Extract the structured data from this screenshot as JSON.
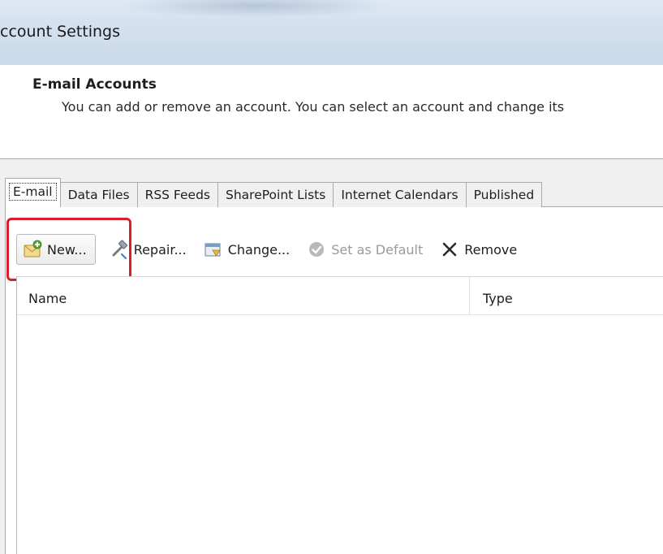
{
  "window": {
    "title": "ccount Settings"
  },
  "header": {
    "heading": "E-mail Accounts",
    "description": "You can add or remove an account. You can select an account and change its"
  },
  "tabs": [
    {
      "label": "E-mail",
      "active": true
    },
    {
      "label": "Data Files"
    },
    {
      "label": "RSS Feeds"
    },
    {
      "label": "SharePoint Lists"
    },
    {
      "label": "Internet Calendars"
    },
    {
      "label": "Published"
    }
  ],
  "toolbar": {
    "new_label": "New...",
    "repair_label": "Repair...",
    "change_label": "Change...",
    "set_default_label": "Set as Default",
    "remove_label": "Remove"
  },
  "icons": {
    "new": "new-account-envelope-icon",
    "repair": "repair-hammer-icon",
    "change": "change-settings-icon",
    "set_default": "checkmark-circle-icon",
    "remove": "x-remove-icon"
  },
  "list": {
    "columns": [
      "Name",
      "Type"
    ],
    "rows": []
  },
  "colors": {
    "highlight": "#d91f2a",
    "titlebar": "#d4e1ef",
    "body": "#f0f0f0"
  }
}
